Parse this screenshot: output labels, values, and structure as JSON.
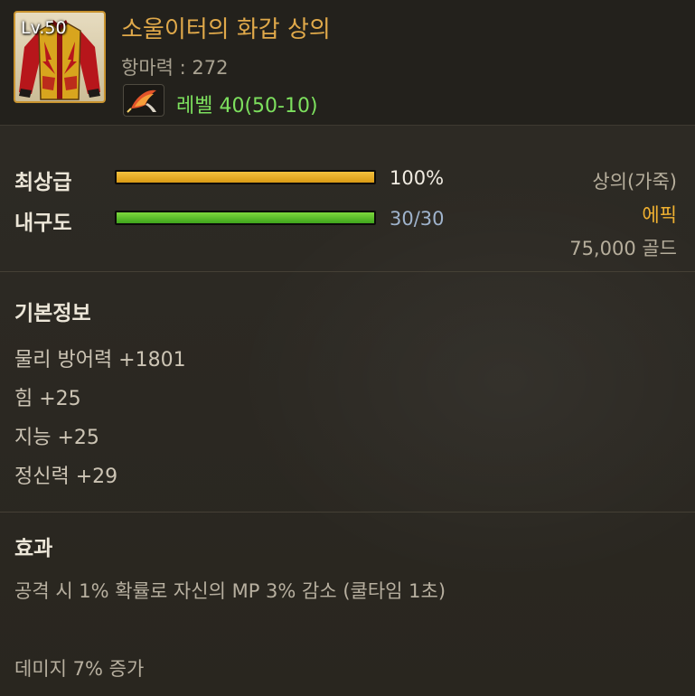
{
  "item": {
    "level_badge": "Lv.50",
    "name": "소울이터의 화갑 상의",
    "resist": "항마력 : 272",
    "level_icon": "phoenix-feather-icon",
    "level_requirement": "레벨 40(50-10)"
  },
  "grade": {
    "label": "최상급",
    "value": "100%",
    "fraction": 1.0
  },
  "durability": {
    "label": "내구도",
    "value": "30/30",
    "fraction": 1.0
  },
  "info": {
    "type": "상의(가죽)",
    "rarity": "에픽",
    "price": "75,000 골드"
  },
  "basic": {
    "title": "기본정보",
    "stats": [
      "물리 방어력 +1801",
      "힘 +25",
      "지능 +25",
      "정신력 +29"
    ]
  },
  "effects": {
    "title": "효과",
    "lines": [
      "공격 시 1% 확률로 자신의 MP 3% 감소 (쿨타임 1초)",
      "데미지 7% 증가"
    ]
  },
  "colors": {
    "item_name": "#e0a94a",
    "rarity_epic": "#f0b131",
    "level_requirement": "#7de05e",
    "grade_bar": "#e8ae22",
    "durability_bar": "#5cc22b",
    "durability_value": "#9fb3cc"
  }
}
